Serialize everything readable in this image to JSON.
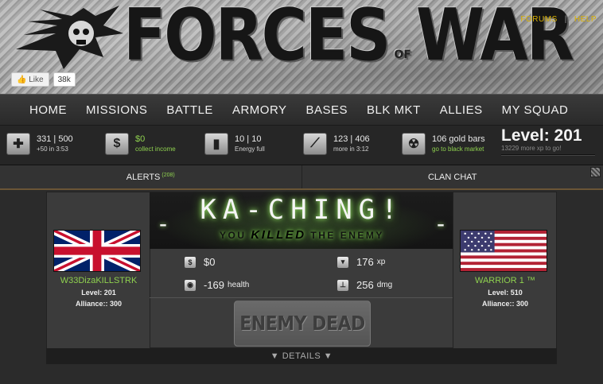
{
  "header": {
    "logo_word1": "FORCES",
    "logo_of": "OF",
    "logo_word2": "WAR",
    "links": [
      "FORUMS",
      "HELP"
    ],
    "like_label": "Like",
    "like_count": "38k"
  },
  "nav": [
    "HOME",
    "MISSIONS",
    "BATTLE",
    "ARMORY",
    "BASES",
    "BLK MKT",
    "ALLIES",
    "MY SQUAD"
  ],
  "stats": [
    {
      "icon": "health-plus-icon",
      "main": "331 | 500",
      "sub": "+50 in 3:53"
    },
    {
      "icon": "dollar-icon",
      "main": "$0",
      "sub": "collect income"
    },
    {
      "icon": "energy-icon",
      "main": "10 | 10",
      "sub": "Energy full"
    },
    {
      "icon": "ammo-icon",
      "main": "123 | 406",
      "sub": "more in 3:12"
    },
    {
      "icon": "gold-icon",
      "main": "106 gold bars",
      "sub": "go to black market"
    }
  ],
  "level": {
    "title": "Level: 201",
    "sub": "13229 more xp to go!"
  },
  "tabs": {
    "alerts": "ALERTS",
    "alerts_count": "(208)",
    "clan": "CLAN CHAT"
  },
  "battle": {
    "headline": "KA-CHING!",
    "subline_pre": "YOU",
    "subline_bold": "KILLED",
    "subline_post": "THE ENEMY",
    "results": [
      {
        "icon": "dollar-icon",
        "value": "$0",
        "unit": ""
      },
      {
        "icon": "xp-icon",
        "value": "176",
        "unit": "xp"
      },
      {
        "icon": "health-icon",
        "value": "-169",
        "unit": "health"
      },
      {
        "icon": "damage-icon",
        "value": "256",
        "unit": "dmg"
      }
    ],
    "status_button": "ENEMY DEAD",
    "details": "▼ DETAILS ▼"
  },
  "player_left": {
    "name": "W33DizaKILLSTRK",
    "level": "Level: 201",
    "alliance": "Alliance:: 300",
    "flag": "uk-flag"
  },
  "player_right": {
    "name": "WARRIOR 1 ™",
    "level": "Level: 510",
    "alliance": "Alliance:: 300",
    "flag": "us-flag"
  },
  "colors": {
    "accent_green": "#8fd14f",
    "link_gold": "#d9b000",
    "tab_border": "#6b5536"
  }
}
